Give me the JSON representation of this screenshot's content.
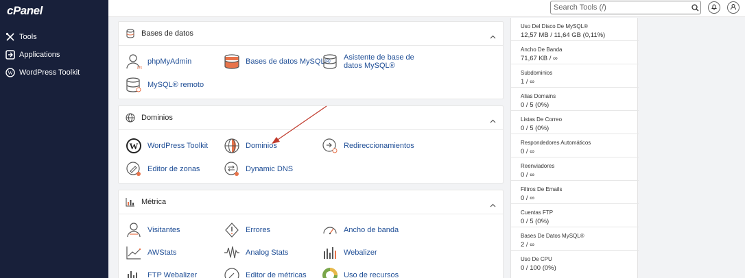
{
  "brand": {
    "logo": "cPanel"
  },
  "sidebar": {
    "items": [
      {
        "label": "Tools",
        "icon": "tools-icon"
      },
      {
        "label": "Applications",
        "icon": "applications-icon"
      },
      {
        "label": "WordPress Toolkit",
        "icon": "wordpress-icon"
      }
    ]
  },
  "topbar": {
    "search_placeholder": "Search Tools (/)"
  },
  "panels": {
    "databases": {
      "title": "Bases de datos",
      "tools": [
        "phpMyAdmin",
        "Bases de datos MySQL®",
        "Asistente de base de datos MySQL®",
        "MySQL® remoto"
      ]
    },
    "domains": {
      "title": "Dominios",
      "tools": [
        "WordPress Toolkit",
        "Dominios",
        "Redireccionamientos",
        "Editor de zonas",
        "Dynamic DNS"
      ]
    },
    "metrics": {
      "title": "Métrica",
      "tools": [
        "Visitantes",
        "Errores",
        "Ancho de banda",
        "AWStats",
        "Analog Stats",
        "Webalizer",
        "FTP Webalizer",
        "Editor de métricas",
        "Uso de recursos"
      ]
    }
  },
  "stats": [
    {
      "label": "Uso Del Disco De MySQL®",
      "value": "12,57 MB / 11,64 GB   (0,11%)"
    },
    {
      "label": "Ancho De Banda",
      "value": "71,67 KB / ∞"
    },
    {
      "label": "Subdominios",
      "value": "1 / ∞"
    },
    {
      "label": "Alias Domains",
      "value": "0 / 5   (0%)"
    },
    {
      "label": "Listas De Correo",
      "value": "0 / 5   (0%)"
    },
    {
      "label": "Respondedores Automáticos",
      "value": "0 / ∞"
    },
    {
      "label": "Reenviadores",
      "value": "0 / ∞"
    },
    {
      "label": "Filtros De Emails",
      "value": "0 / ∞"
    },
    {
      "label": "Cuentas FTP",
      "value": "0 / 5   (0%)"
    },
    {
      "label": "Bases De Datos MySQL®",
      "value": "2 / ∞"
    },
    {
      "label": "Uso De CPU",
      "value": "0 / 100   (0%)"
    }
  ],
  "colors": {
    "sidebar": "#18203a",
    "link": "#1f4e96",
    "accent": "#e8734a",
    "arrow": "#c0392b"
  }
}
